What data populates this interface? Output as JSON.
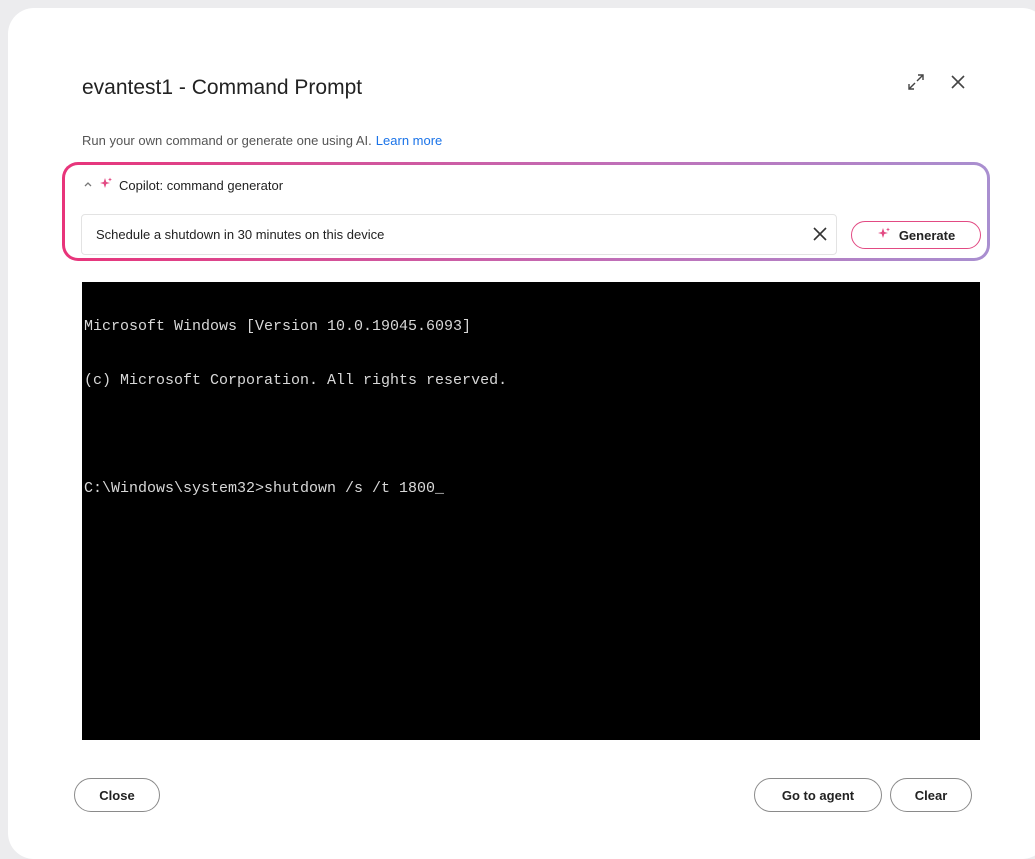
{
  "dialog": {
    "title": "evantest1 - Command Prompt",
    "subtitle": "Run your own command or generate one using AI.",
    "learn_more": "Learn more"
  },
  "copilot": {
    "header": "Copilot: command generator",
    "input_value": "Schedule a shutdown in 30 minutes on this device",
    "generate_label": "Generate",
    "gradient_colors": [
      "#e8347a",
      "#c06fb8",
      "#a98fd0"
    ]
  },
  "terminal": {
    "lines": [
      "Microsoft Windows [Version 10.0.19045.6093]",
      "(c) Microsoft Corporation. All rights reserved.",
      "",
      "C:\\Windows\\system32>shutdown /s /t 1800_"
    ]
  },
  "footer": {
    "close_label": "Close",
    "agent_label": "Go to agent",
    "clear_label": "Clear"
  },
  "icons": {
    "expand": "expand-icon",
    "close": "close-icon",
    "sparkle": "sparkle-icon",
    "chevron": "chevron-up-icon",
    "clear": "clear-input-icon"
  }
}
